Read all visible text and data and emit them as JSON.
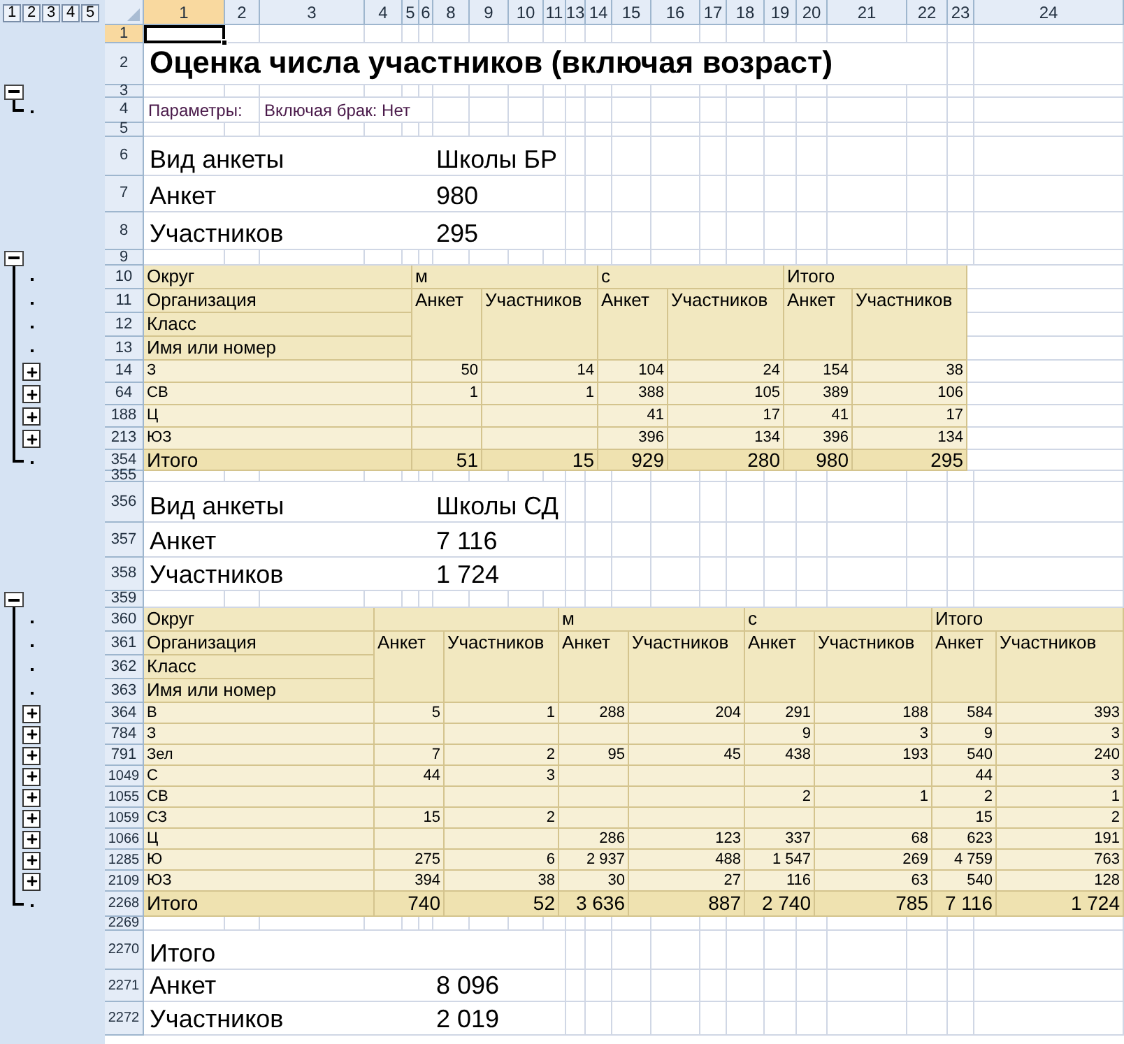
{
  "outline_levels": [
    "1",
    "2",
    "3",
    "4",
    "5"
  ],
  "columns": [
    {
      "label": "1",
      "selected": true
    },
    {
      "label": "2",
      "selected": false
    },
    {
      "label": "3",
      "selected": false
    },
    {
      "label": "4",
      "selected": false
    },
    {
      "label": "5",
      "selected": false
    },
    {
      "label": "6",
      "selected": false
    },
    {
      "label": "8",
      "selected": false
    },
    {
      "label": "9",
      "selected": false
    },
    {
      "label": "10",
      "selected": false
    },
    {
      "label": "11",
      "selected": false
    },
    {
      "label": "13",
      "selected": false
    },
    {
      "label": "14",
      "selected": false
    },
    {
      "label": "15",
      "selected": false
    },
    {
      "label": "16",
      "selected": false
    },
    {
      "label": "17",
      "selected": false
    },
    {
      "label": "18",
      "selected": false
    },
    {
      "label": "19",
      "selected": false
    },
    {
      "label": "20",
      "selected": false
    },
    {
      "label": "21",
      "selected": false
    },
    {
      "label": "22",
      "selected": false
    },
    {
      "label": "23",
      "selected": false
    },
    {
      "label": "24",
      "selected": false
    }
  ],
  "sheet": [
    {
      "kind": "blank",
      "row": "1",
      "selected": true
    },
    {
      "kind": "title",
      "row": "2",
      "text": "Оценка числа участников (включая возраст)"
    },
    {
      "kind": "blank",
      "row": "3",
      "selected": false,
      "outline": {
        "kind": "collapse"
      }
    },
    {
      "kind": "params",
      "row": "4",
      "outline": {
        "kind": "end"
      },
      "label": "Параметры:",
      "value": "Включая брак: Нет"
    },
    {
      "kind": "blank",
      "row": "5",
      "selected": false
    },
    {
      "kind": "field",
      "row": "6",
      "label": "Вид анкеты",
      "value": "Школы БР"
    },
    {
      "kind": "field",
      "row": "7",
      "label": "Анкет",
      "value": "980"
    },
    {
      "kind": "field",
      "row": "8",
      "label": "Участников",
      "value": "295"
    },
    {
      "kind": "blank",
      "row": "9",
      "selected": false,
      "outline": {
        "kind": "collapse"
      }
    },
    {
      "kind": "table",
      "header_rows": [
        {
          "row": "10",
          "outline": {
            "kind": "dot"
          },
          "label": "Округ"
        },
        {
          "row": "11",
          "outline": {
            "kind": "dot"
          },
          "label": "Организация"
        },
        {
          "row": "12",
          "outline": {
            "kind": "dot"
          },
          "label": "Класс"
        },
        {
          "row": "13",
          "outline": {
            "kind": "dot"
          },
          "label": "Имя или номер"
        }
      ],
      "groups": [
        {
          "label": "м",
          "columns": [
            "Анкет",
            "Участников"
          ]
        },
        {
          "label": "с",
          "columns": [
            "Анкет",
            "Участников"
          ]
        },
        {
          "label": "Итого",
          "columns": [
            "Анкет",
            "Участников"
          ]
        }
      ],
      "rows": [
        {
          "row": "14",
          "outline": {
            "kind": "plus"
          },
          "kind": "item",
          "name": "З",
          "cells": [
            "50",
            "14",
            "104",
            "24",
            "154",
            "38"
          ]
        },
        {
          "row": "64",
          "outline": {
            "kind": "plus"
          },
          "kind": "item",
          "name": "СВ",
          "cells": [
            "1",
            "1",
            "388",
            "105",
            "389",
            "106"
          ]
        },
        {
          "row": "188",
          "outline": {
            "kind": "plus"
          },
          "kind": "item",
          "name": "Ц",
          "cells": [
            null,
            null,
            "41",
            "17",
            "41",
            "17"
          ]
        },
        {
          "row": "213",
          "outline": {
            "kind": "plus"
          },
          "kind": "item",
          "name": "ЮЗ",
          "cells": [
            null,
            null,
            "396",
            "134",
            "396",
            "134"
          ]
        },
        {
          "row": "354",
          "outline": {
            "kind": "end"
          },
          "kind": "total",
          "name": "Итого",
          "cells": [
            "51",
            "15",
            "929",
            "280",
            "980",
            "295"
          ]
        }
      ]
    },
    {
      "kind": "blank",
      "row": "355",
      "selected": false
    },
    {
      "kind": "field",
      "row": "356",
      "label": "Вид анкеты",
      "value": "Школы СД"
    },
    {
      "kind": "field",
      "row": "357",
      "label": "Анкет",
      "value": "7 116"
    },
    {
      "kind": "field",
      "row": "358",
      "label": "Участников",
      "value": "1 724"
    },
    {
      "kind": "blank",
      "row": "359",
      "selected": false,
      "outline": {
        "kind": "collapse"
      }
    },
    {
      "kind": "table",
      "header_rows": [
        {
          "row": "360",
          "outline": {
            "kind": "dot"
          },
          "label": "Округ"
        },
        {
          "row": "361",
          "outline": {
            "kind": "dot"
          },
          "label": "Организация"
        },
        {
          "row": "362",
          "outline": {
            "kind": "dot"
          },
          "label": "Класс"
        },
        {
          "row": "363",
          "outline": {
            "kind": "dot"
          },
          "label": "Имя или номер"
        }
      ],
      "groups": [
        {
          "columns": [
            "Анкет",
            "Участников"
          ]
        },
        {
          "label": "м",
          "columns": [
            "Анкет",
            "Участников"
          ]
        },
        {
          "label": "с",
          "columns": [
            "Анкет",
            "Участников"
          ]
        },
        {
          "label": "Итого",
          "columns": [
            "Анкет",
            "Участников"
          ]
        }
      ],
      "rows": [
        {
          "row": "364",
          "outline": {
            "kind": "plus"
          },
          "kind": "item",
          "name": "В",
          "cells": [
            "5",
            "1",
            "288",
            "204",
            "291",
            "188",
            "584",
            "393"
          ]
        },
        {
          "row": "784",
          "outline": {
            "kind": "plus"
          },
          "kind": "item",
          "name": "З",
          "cells": [
            null,
            null,
            null,
            null,
            "9",
            "3",
            "9",
            "3"
          ]
        },
        {
          "row": "791",
          "outline": {
            "kind": "plus"
          },
          "kind": "item",
          "name": "Зел",
          "cells": [
            "7",
            "2",
            "95",
            "45",
            "438",
            "193",
            "540",
            "240"
          ]
        },
        {
          "row": "1049",
          "outline": {
            "kind": "plus"
          },
          "kind": "item",
          "name": "С",
          "cells": [
            "44",
            "3",
            null,
            null,
            null,
            null,
            "44",
            "3"
          ]
        },
        {
          "row": "1055",
          "outline": {
            "kind": "plus"
          },
          "kind": "item",
          "name": "СВ",
          "cells": [
            null,
            null,
            null,
            null,
            "2",
            "1",
            "2",
            "1"
          ]
        },
        {
          "row": "1059",
          "outline": {
            "kind": "plus"
          },
          "kind": "item",
          "name": "СЗ",
          "cells": [
            "15",
            "2",
            null,
            null,
            null,
            null,
            "15",
            "2"
          ]
        },
        {
          "row": "1066",
          "outline": {
            "kind": "plus"
          },
          "kind": "item",
          "name": "Ц",
          "cells": [
            null,
            null,
            "286",
            "123",
            "337",
            "68",
            "623",
            "191"
          ]
        },
        {
          "row": "1285",
          "outline": {
            "kind": "plus"
          },
          "kind": "item",
          "name": "Ю",
          "cells": [
            "275",
            "6",
            "2 937",
            "488",
            "1 547",
            "269",
            "4 759",
            "763"
          ]
        },
        {
          "row": "2109",
          "outline": {
            "kind": "plus"
          },
          "kind": "item",
          "name": "ЮЗ",
          "cells": [
            "394",
            "38",
            "30",
            "27",
            "116",
            "63",
            "540",
            "128"
          ]
        },
        {
          "row": "2268",
          "outline": {
            "kind": "end"
          },
          "kind": "total",
          "name": "Итого",
          "cells": [
            "740",
            "52",
            "3 636",
            "887",
            "2 740",
            "785",
            "7 116",
            "1 724"
          ]
        }
      ]
    },
    {
      "kind": "blank",
      "row": "2269",
      "selected": false
    },
    {
      "kind": "field",
      "row": "2270",
      "label": "Итого"
    },
    {
      "kind": "field",
      "row": "2271",
      "label": "Анкет",
      "value": "8 096"
    },
    {
      "kind": "field",
      "row": "2272",
      "label": "Участников",
      "value": "2 019"
    }
  ]
}
